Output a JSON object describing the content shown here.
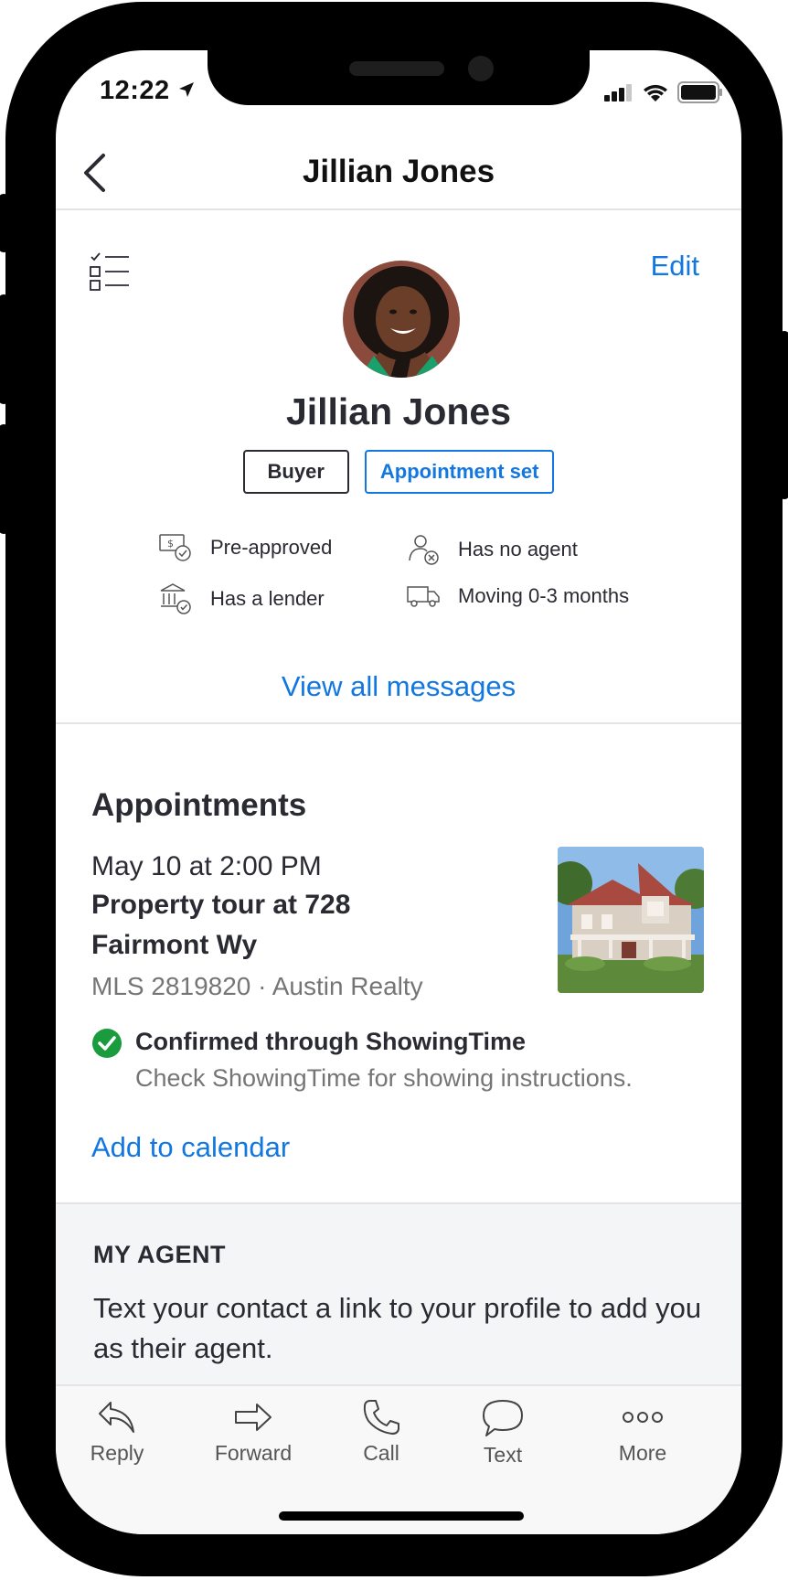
{
  "status_bar": {
    "time": "12:22"
  },
  "nav": {
    "title": "Jillian Jones"
  },
  "profile": {
    "edit_label": "Edit",
    "name": "Jillian Jones",
    "badges": [
      "Buyer",
      "Appointment set"
    ],
    "attributes": [
      {
        "icon": "money-check-icon",
        "label": "Pre-approved"
      },
      {
        "icon": "person-x-icon",
        "label": "Has no agent"
      },
      {
        "icon": "bank-check-icon",
        "label": "Has a lender"
      },
      {
        "icon": "truck-icon",
        "label": "Moving 0-3 months"
      }
    ],
    "view_messages_label": "View all messages"
  },
  "appointments": {
    "heading": "Appointments",
    "date": "May 10 at 2:00 PM",
    "title": "Property tour at 728 Fairmont Wy",
    "mls": "MLS 2819820 · Austin Realty",
    "confirm_title": "Confirmed through ShowingTime",
    "confirm_subtitle": "Check ShowingTime for showing instructions.",
    "add_calendar_label": "Add to calendar"
  },
  "agent": {
    "heading": "MY AGENT",
    "text": "Text your contact a link to your profile to add you as their agent."
  },
  "tabbar": {
    "items": [
      {
        "icon": "reply-icon",
        "label": "Reply"
      },
      {
        "icon": "forward-icon",
        "label": "Forward"
      },
      {
        "icon": "phone-icon",
        "label": "Call"
      },
      {
        "icon": "chat-bubble-icon",
        "label": "Text"
      },
      {
        "icon": "more-icon",
        "label": "More"
      }
    ]
  },
  "colors": {
    "accent": "#1277e1",
    "confirm_green": "#1a9c3e",
    "text": "#2a2a33",
    "muted": "#757575"
  }
}
